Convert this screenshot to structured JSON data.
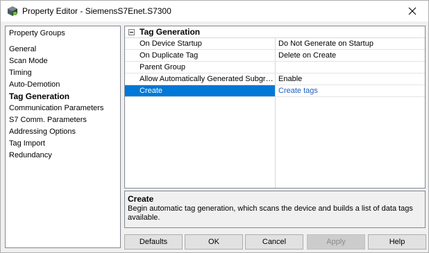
{
  "window": {
    "title": "Property Editor - SiemensS7Enet.S7300"
  },
  "left_panel": {
    "header": "Property Groups",
    "items": [
      {
        "label": "General",
        "active": false
      },
      {
        "label": "Scan Mode",
        "active": false
      },
      {
        "label": "Timing",
        "active": false
      },
      {
        "label": "Auto-Demotion",
        "active": false
      },
      {
        "label": "Tag Generation",
        "active": true
      },
      {
        "label": "Communication Parameters",
        "active": false
      },
      {
        "label": "S7 Comm. Parameters",
        "active": false
      },
      {
        "label": "Addressing Options",
        "active": false
      },
      {
        "label": "Tag Import",
        "active": false
      },
      {
        "label": "Redundancy",
        "active": false
      }
    ]
  },
  "grid": {
    "category": "Tag Generation",
    "rows": [
      {
        "name": "On Device Startup",
        "value": "Do Not Generate on Startup"
      },
      {
        "name": "On Duplicate Tag",
        "value": "Delete on Create"
      },
      {
        "name": "Parent Group",
        "value": ""
      },
      {
        "name": "Allow Automatically Generated Subgro...",
        "value": "Enable"
      },
      {
        "name": "Create",
        "value": "Create tags",
        "selected": true,
        "link": true
      }
    ]
  },
  "description": {
    "title": "Create",
    "text": "Begin automatic tag generation, which scans the device and builds a list of data tags available."
  },
  "buttons": {
    "defaults": "Defaults",
    "ok": "OK",
    "cancel": "Cancel",
    "apply": "Apply",
    "help": "Help"
  },
  "icons": {
    "app": "property-editor-icon",
    "close": "close-icon",
    "collapse": "collapse-minus-icon"
  }
}
